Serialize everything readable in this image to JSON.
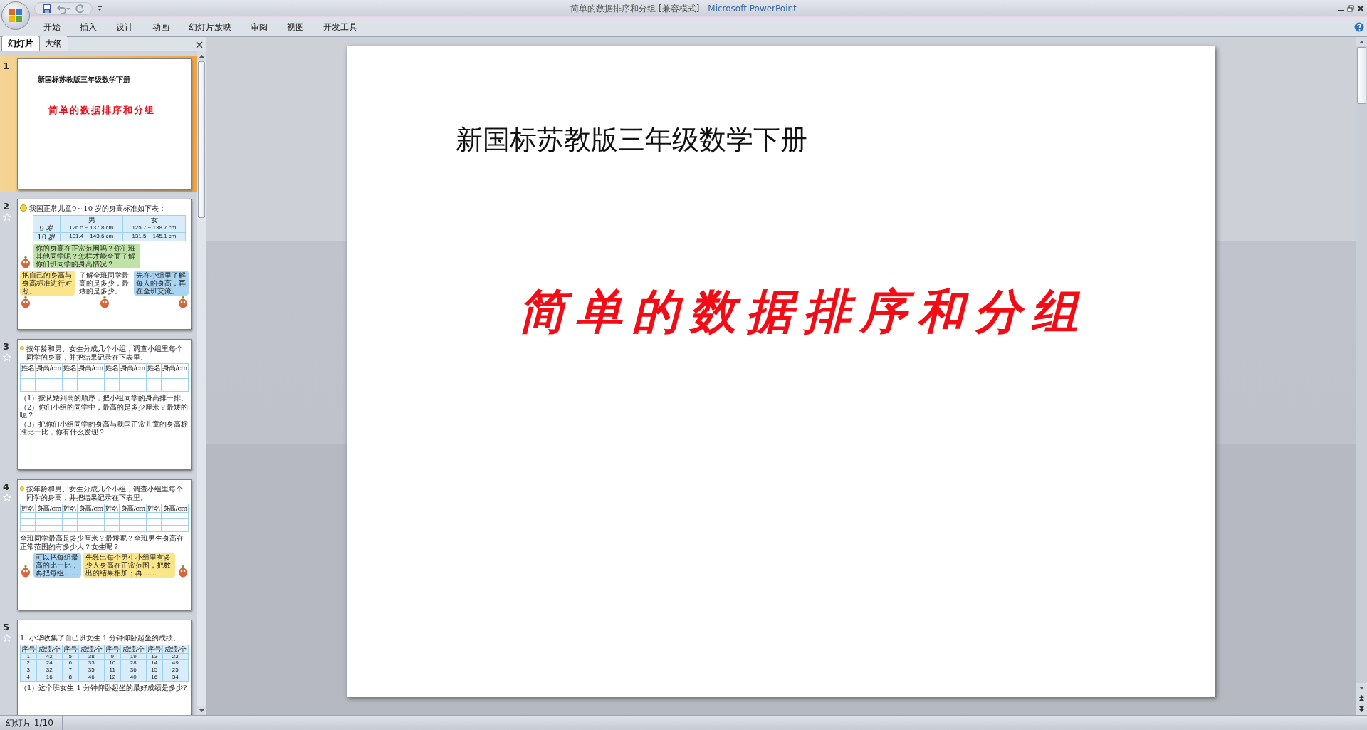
{
  "window": {
    "title": "简单的数据排序和分组 [兼容模式] -",
    "app": "Microsoft PowerPoint"
  },
  "ribbon_tabs": [
    "开始",
    "插入",
    "设计",
    "动画",
    "幻灯片放映",
    "审阅",
    "视图",
    "开发工具"
  ],
  "panel_tabs": [
    {
      "label": "幻灯片",
      "selected": true
    },
    {
      "label": "大纲",
      "selected": false
    }
  ],
  "slides": [
    {
      "number": "1",
      "selected": true,
      "animated": false,
      "kind": "title",
      "subtitle": "新国标苏教版三年级数学下册",
      "title": "简单的数据排序和分组"
    },
    {
      "number": "2",
      "selected": false,
      "animated": true,
      "kind": "standard",
      "heading": "我国正常儿童9～10 岁的身高标准如下表：",
      "table": {
        "columns": [
          "",
          "男",
          "女"
        ],
        "rows": [
          [
            "9 岁",
            "126.5 ~ 137.8 cm",
            "125.7 ~ 138.7 cm"
          ],
          [
            "10 岁",
            "131.4 ~ 143.6 cm",
            "131.5 ~ 145.1 cm"
          ]
        ]
      },
      "bubbles": [
        {
          "text": "你的身高在正常范围吗？你们班其他同学呢？怎样才能全面了解你们班同学的身高情况？",
          "color": "#bfe3a6"
        },
        {
          "text": "把自己的身高与身高标准进行对照。",
          "color": "#fbe58a"
        },
        {
          "text": "了解全班同学最高的是多少，最矮的是多少。",
          "color": "#ffffff"
        },
        {
          "text": "先在小组里了解每人的身高，再在全班交流。",
          "color": "#a9d4f2"
        }
      ]
    },
    {
      "number": "3",
      "selected": false,
      "animated": true,
      "kind": "survey",
      "heading": "按年龄和男、女生分成几个小组，调查小组里每个同学的身高，并把结果记录在下表里。",
      "table": {
        "columns": [
          "姓名",
          "身高/cm",
          "姓名",
          "身高/cm",
          "姓名",
          "身高/cm",
          "姓名",
          "身高/cm"
        ]
      },
      "questions": [
        "（1）按从矮到高的顺序，把小组同学的身高排一排。",
        "（2）你们小组的同学中，最高的是多少厘米？最矮的呢？",
        "（3）把你们小组同学的身高与我国正常儿童的身高标准比一比，你有什么发现？"
      ]
    },
    {
      "number": "4",
      "selected": false,
      "animated": true,
      "kind": "survey",
      "heading": "按年龄和男、女生分成几个小组，调查小组里每个同学的身高，并把结果记录在下表里。",
      "table": {
        "columns": [
          "姓名",
          "身高/cm",
          "姓名",
          "身高/cm",
          "姓名",
          "身高/cm",
          "姓名",
          "身高/cm"
        ]
      },
      "questions": [
        "全班同学最高是多少厘米？最矮呢？全班男生身高在正常范围的有多少人？女生呢？"
      ],
      "bubbles": [
        {
          "text": "可以把每组最高的比一比，再把每组……",
          "color": "#a9d4f2"
        },
        {
          "text": "先数出每个男生小组里有多少人身高在正常范围，把数出的结果相加；再……",
          "color": "#fbe58a"
        }
      ]
    },
    {
      "number": "5",
      "selected": false,
      "animated": true,
      "kind": "scores",
      "heading": "1. 小华收集了自己班女生 1 分钟仰卧起坐的成绩。",
      "table": {
        "columns": [
          "序号",
          "成绩/个",
          "序号",
          "成绩/个",
          "序号",
          "成绩/个",
          "序号",
          "成绩/个"
        ],
        "rows": [
          [
            "1",
            "42",
            "5",
            "38",
            "9",
            "19",
            "13",
            "23"
          ],
          [
            "2",
            "24",
            "6",
            "33",
            "10",
            "28",
            "14",
            "49"
          ],
          [
            "3",
            "32",
            "7",
            "35",
            "11",
            "36",
            "15",
            "25"
          ],
          [
            "4",
            "16",
            "8",
            "46",
            "12",
            "40",
            "16",
            "34"
          ]
        ]
      },
      "questions": [
        "（1）这个班女生 1 分钟仰卧起坐的最好成绩是多少?"
      ]
    }
  ],
  "slide_view": {
    "subtitle": "新国标苏教版三年级数学下册",
    "title": "简单的数据排序和分组"
  },
  "status_bar": {
    "text": "幻灯片 1/10"
  }
}
